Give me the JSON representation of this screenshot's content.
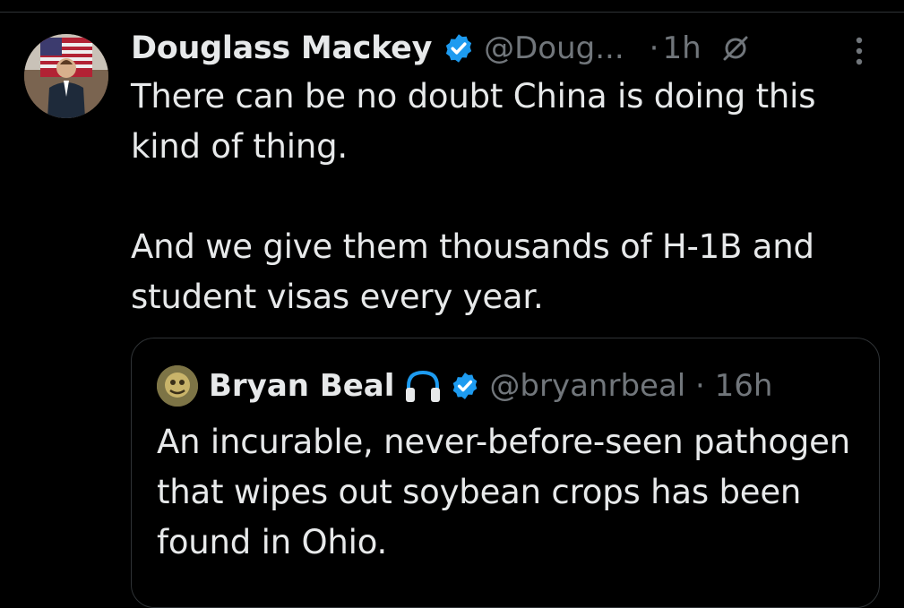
{
  "tweet": {
    "author_name": "Douglass Mackey",
    "author_handle": "@Doug...",
    "separator": "·",
    "time": "1h",
    "text_line1": "There can be no doubt China is doing this kind of thing.",
    "text_line2": "And we give them thousands of H-1B and student visas every year."
  },
  "quote": {
    "author_name": "Bryan Beal",
    "author_handle": "@bryanrbeal · 16h",
    "text": "An incurable, never-before-seen pathogen that wipes out soybean crops has been found in Ohio."
  },
  "icons": {
    "verified": "verified-badge-icon",
    "reply_restricted": "no-reply-icon",
    "more": "more-options-icon",
    "headphones": "headphones-icon"
  },
  "colors": {
    "background": "#000000",
    "text": "#e7e9ea",
    "muted": "#71767b",
    "verified": "#1d9bf0",
    "border": "#2f3336"
  }
}
